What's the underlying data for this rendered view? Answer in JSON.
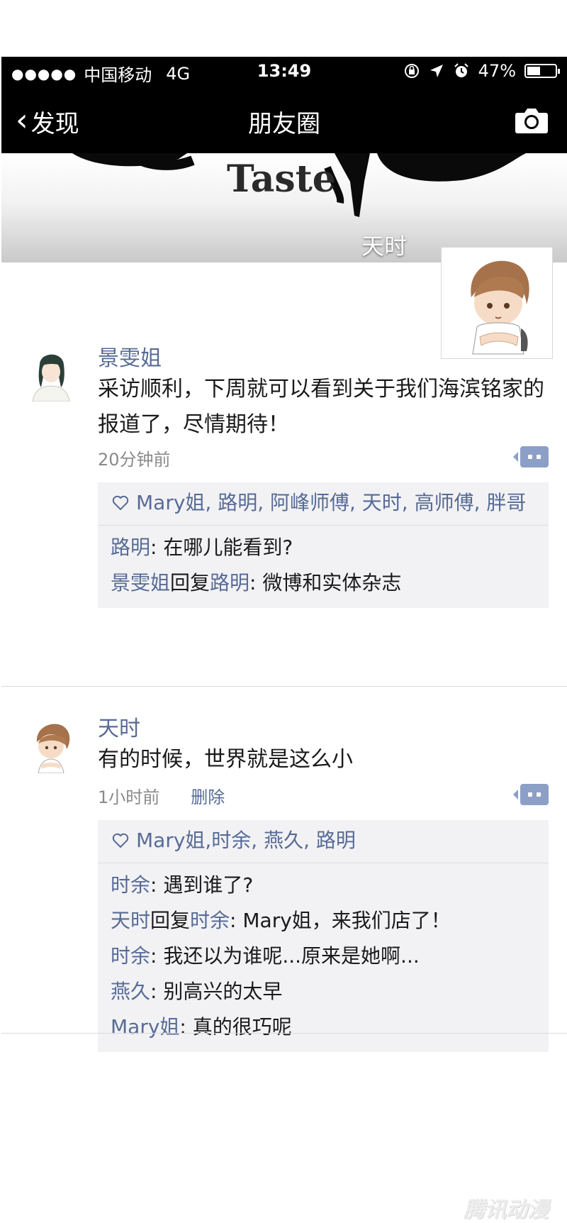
{
  "status_bar": {
    "carrier": "中国移动",
    "network": "4G",
    "time": "13:49",
    "battery": "47%",
    "battery_level": 0.47
  },
  "nav": {
    "back_label": "发现",
    "title": "朋友圈",
    "camera_icon": "camera-icon"
  },
  "cover": {
    "brand_text": "Taste",
    "user_name": "天时"
  },
  "posts": [
    {
      "author": "景雯姐",
      "content": "采访顺利，下周就可以看到关于我们海滨铭家的报道了，尽情期待！",
      "time": "20分钟前",
      "likes": "Mary姐, 路明, 阿峰师傅, 天时, 高师傅, 胖哥",
      "comments": [
        {
          "author": "路明",
          "reply_to": "",
          "text": ": 在哪儿能看到?"
        },
        {
          "author": "景雯姐",
          "reply_to": "路明",
          "text": ": 微博和实体杂志"
        }
      ]
    },
    {
      "author": "天时",
      "content": "有的时候，世界就是这么小",
      "time": "1小时前",
      "delete_label": "删除",
      "likes": "Mary姐,时余, 燕久, 路明",
      "comments": [
        {
          "author": "时余",
          "reply_to": "",
          "text": ": 遇到谁了?"
        },
        {
          "author": "天时",
          "reply_to": "时余",
          "text": ": Mary姐，来我们店了！"
        },
        {
          "author": "时余",
          "reply_to": "",
          "text": ": 我还以为谁呢...原来是她啊..."
        },
        {
          "author": "燕久",
          "reply_to": "",
          "text": ": 别高兴的太早"
        },
        {
          "author": "Mary姐",
          "reply_to": "",
          "text": ": 真的很巧呢"
        }
      ]
    }
  ],
  "reply_word": "回复",
  "watermark": "腾讯动漫",
  "colors": {
    "link": "#576b95",
    "bar": "#000000",
    "comment_bg": "#f2f2f5"
  }
}
